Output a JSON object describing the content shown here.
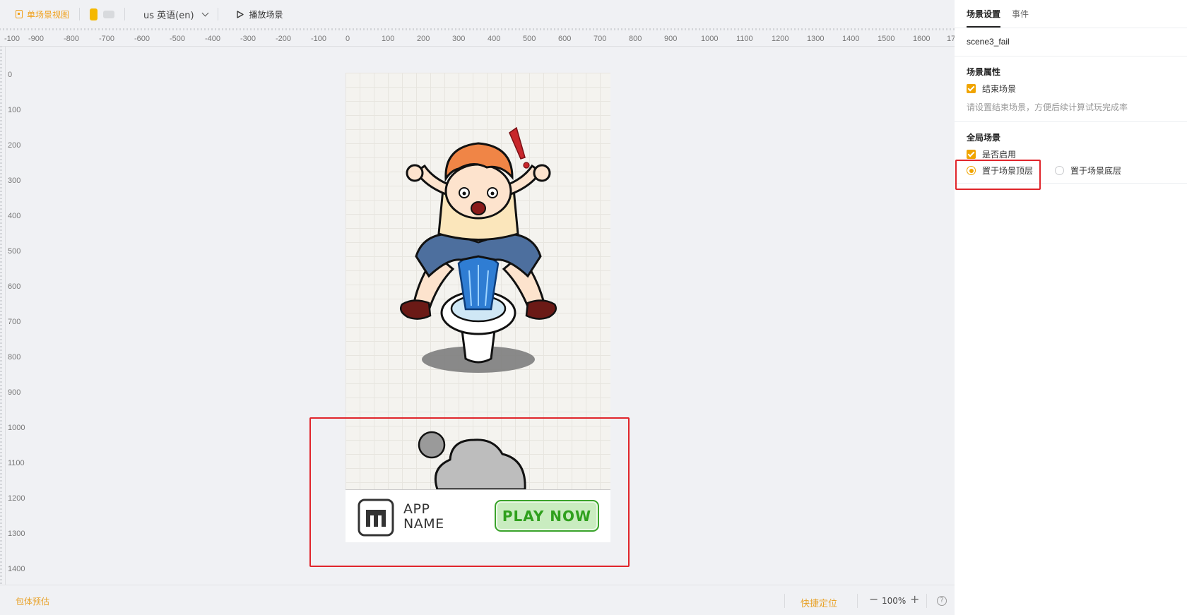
{
  "toolbar": {
    "view_label": "单场景视图",
    "language": "us 英语(en)",
    "play_label": "播放场景"
  },
  "ruler": {
    "top_labels": [
      "-100",
      "-900",
      "-800",
      "-700",
      "-600",
      "-500",
      "-400",
      "-300",
      "-200",
      "-100",
      "0",
      "100",
      "200",
      "300",
      "400",
      "500",
      "600",
      "700",
      "800",
      "900",
      "1000",
      "1100",
      "1200",
      "1300",
      "1400",
      "1500",
      "1600",
      "17"
    ],
    "left_labels": [
      "0",
      "100",
      "200",
      "300",
      "400",
      "500",
      "600",
      "700",
      "800",
      "900",
      "1000",
      "1100",
      "1200",
      "1300",
      "1400"
    ]
  },
  "banner": {
    "app_name_line1": "APP",
    "app_name_line2": "NAME",
    "cta": "PLAY NOW"
  },
  "statusbar": {
    "estimate": "包体预估",
    "locate": "快捷定位",
    "zoom": "100%",
    "minus": "−",
    "plus": "+",
    "help": "?"
  },
  "panel": {
    "tabs": [
      "场景设置",
      "事件"
    ],
    "scene_name": "scene3_fail",
    "scene_props": {
      "title": "场景属性",
      "end_scene_label": "结束场景",
      "end_scene_checked": true,
      "hint": "请设置结束场景，方便后续计算试玩完成率"
    },
    "global_scene": {
      "title": "全局场景",
      "enable_label": "是否启用",
      "enable_checked": true,
      "options": [
        "置于场景顶层",
        "置于场景底层"
      ],
      "selected": "置于场景顶层"
    }
  },
  "colors": {
    "accent": "#f0a400",
    "highlight": "#e0252b",
    "cta_green": "#2fa01d"
  }
}
